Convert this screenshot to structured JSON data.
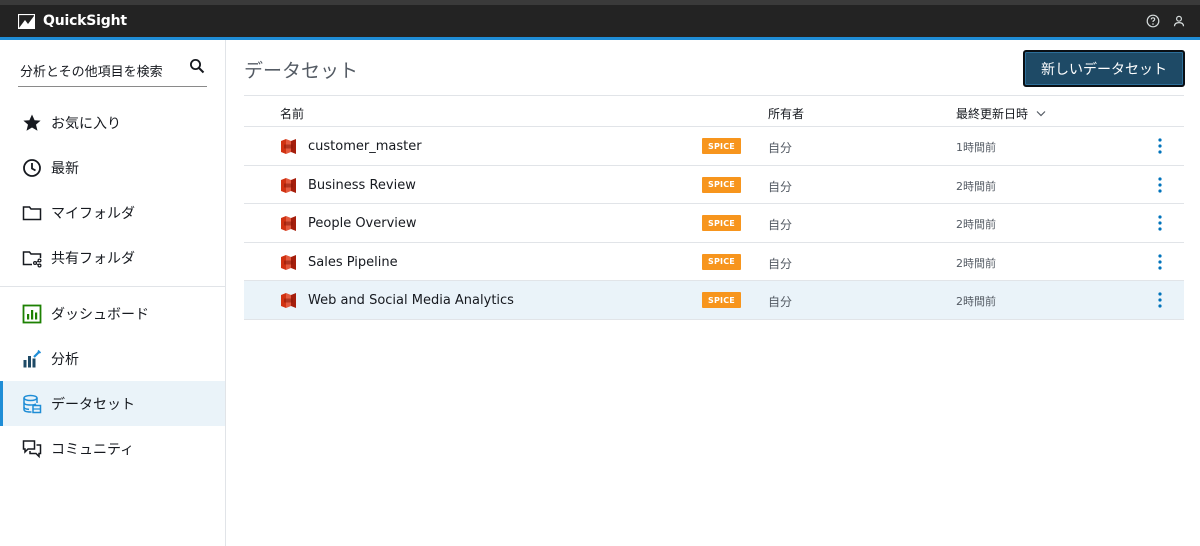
{
  "app": {
    "name": "QuickSight"
  },
  "header": {
    "icons": [
      "help-icon",
      "user-icon"
    ]
  },
  "sidebar": {
    "search": {
      "value": "分析とその他項目を検索",
      "icon": "search-icon"
    },
    "items_top": [
      {
        "label": "お気に入り",
        "icon": "star-icon"
      },
      {
        "label": "最新",
        "icon": "clock-icon"
      },
      {
        "label": "マイフォルダ",
        "icon": "folder-icon"
      },
      {
        "label": "共有フォルダ",
        "icon": "shared-folder-icon"
      }
    ],
    "items_bottom": [
      {
        "label": "ダッシュボード",
        "icon": "dashboard-icon"
      },
      {
        "label": "分析",
        "icon": "analysis-icon"
      },
      {
        "label": "データセット",
        "icon": "dataset-icon",
        "active": true
      },
      {
        "label": "コミュニティ",
        "icon": "community-icon"
      }
    ]
  },
  "main": {
    "title": "データセット",
    "new_button": "新しいデータセット",
    "columns": {
      "name": "名前",
      "owner": "所有者",
      "updated": "最終更新日時"
    },
    "rows": [
      {
        "name": "customer_master",
        "badge": "SPICE",
        "owner": "自分",
        "updated": "1時間前"
      },
      {
        "name": "Business Review",
        "badge": "SPICE",
        "owner": "自分",
        "updated": "2時間前"
      },
      {
        "name": "People Overview",
        "badge": "SPICE",
        "owner": "自分",
        "updated": "2時間前"
      },
      {
        "name": "Sales Pipeline",
        "badge": "SPICE",
        "owner": "自分",
        "updated": "2時間前"
      },
      {
        "name": "Web and Social Media Analytics",
        "badge": "SPICE",
        "owner": "自分",
        "updated": "2時間前",
        "selected": true
      }
    ]
  },
  "colors": {
    "header_bg": "#232323",
    "accent": "#1f8dd6",
    "primary_button": "#1e4a66",
    "spice_badge": "#f7951d",
    "dataset_icon": "#d13212",
    "selected_row": "#eaf3f9",
    "kebab": "#0073bb"
  }
}
